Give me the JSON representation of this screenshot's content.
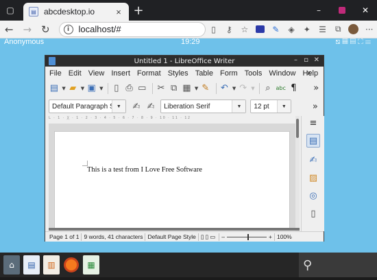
{
  "browser": {
    "tab_title": "abcdesktop.io",
    "tab_close": "×",
    "new_tab": "+",
    "address": "localhost/#",
    "win_controls": [
      "–",
      "□",
      "✕"
    ]
  },
  "desktop": {
    "user": "Anonymous",
    "clock": "19:29",
    "tray_icons": [
      "network-icon",
      "grid-icon",
      "files-icon",
      "fullscreen-icon",
      "menu-icon"
    ]
  },
  "writer": {
    "window_title": "Untitled 1 - LibreOffice Writer",
    "title_controls": [
      "–",
      "▫",
      "✕"
    ],
    "menu": [
      "File",
      "Edit",
      "View",
      "Insert",
      "Format",
      "Styles",
      "Table",
      "Form",
      "Tools",
      "Window",
      "Help"
    ],
    "menu_close": "×",
    "paragraph_style": "Default Paragraph St",
    "font_name": "Liberation Serif",
    "font_size": "12 pt",
    "ruler_ticks": "L · 1 · ╳ · 1 · 2 · 3 · 4 · 5 · 6 · 7 · 8 · 9 · 10 · 11 · 12",
    "document_text": "This is a test from I Love Free Software",
    "status": {
      "page": "Page 1 of 1",
      "words": "9 words, 41 characters",
      "page_style": "Default Page Style",
      "zoom_minus": "–",
      "zoom_plus": "+",
      "zoom": "100%"
    },
    "toolbar_more": "»",
    "abc_label": "abc"
  },
  "dock": {
    "search_icon": "⚲"
  }
}
